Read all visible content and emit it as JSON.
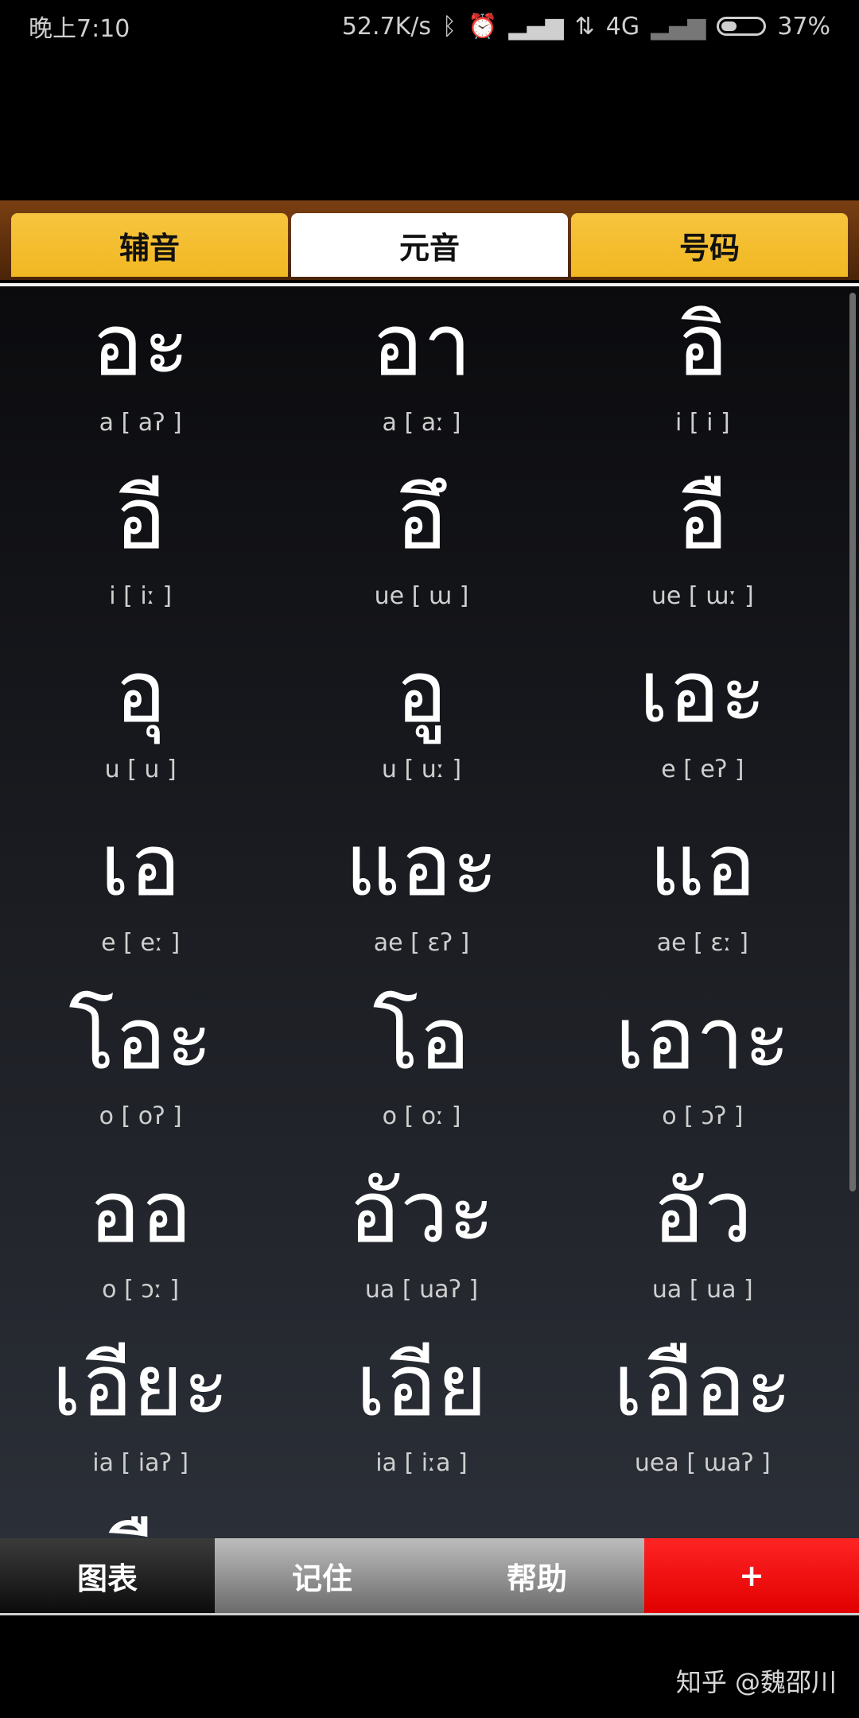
{
  "status_bar": {
    "time": "晚上7:10",
    "network_speed": "52.7K/s",
    "network_type": "4G",
    "battery": "37%",
    "battery_level": 0.37,
    "icons": [
      "bluetooth-icon",
      "alarm-icon",
      "signal-icon",
      "data-arrows-icon",
      "signal-weak-icon",
      "battery-icon"
    ]
  },
  "tabs": [
    {
      "label": "辅音",
      "active": false
    },
    {
      "label": "元音",
      "active": true
    },
    {
      "label": "号码",
      "active": false
    }
  ],
  "vowels": [
    {
      "thai": "อะ",
      "roman": "a [ aʔ ]"
    },
    {
      "thai": "อา",
      "roman": "a [ aː ]"
    },
    {
      "thai": "อิ",
      "roman": "i [ i ]"
    },
    {
      "thai": "อี",
      "roman": "i [ iː ]"
    },
    {
      "thai": "อึ",
      "roman": "ue [ ɯ ]"
    },
    {
      "thai": "อื",
      "roman": "ue [ ɯː ]"
    },
    {
      "thai": "อุ",
      "roman": "u [ u ]"
    },
    {
      "thai": "อู",
      "roman": "u [ uː ]"
    },
    {
      "thai": "เอะ",
      "roman": "e [ eʔ ]"
    },
    {
      "thai": "เอ",
      "roman": "e [ eː ]"
    },
    {
      "thai": "แอะ",
      "roman": "ae [ ɛʔ ]"
    },
    {
      "thai": "แอ",
      "roman": "ae [ ɛː ]"
    },
    {
      "thai": "โอะ",
      "roman": "o [ oʔ ]"
    },
    {
      "thai": "โอ",
      "roman": "o [ oː ]"
    },
    {
      "thai": "เอาะ",
      "roman": "o [ ɔʔ ]"
    },
    {
      "thai": "ออ",
      "roman": "o [ ɔː ]"
    },
    {
      "thai": "อัวะ",
      "roman": "ua [ uaʔ ]"
    },
    {
      "thai": "อัว",
      "roman": "ua [ ua ]"
    },
    {
      "thai": "เอียะ",
      "roman": "ia [ iaʔ ]"
    },
    {
      "thai": "เอีย",
      "roman": "ia [ iːa ]"
    },
    {
      "thai": "เอือะ",
      "roman": "uea [ ɯaʔ ]"
    },
    {
      "thai": "เอือ",
      "roman": ""
    }
  ],
  "bottom_nav": [
    {
      "label": "图表"
    },
    {
      "label": "记住"
    },
    {
      "label": "帮助"
    },
    {
      "label": "+"
    }
  ],
  "watermark": "知乎 @魏邵川"
}
